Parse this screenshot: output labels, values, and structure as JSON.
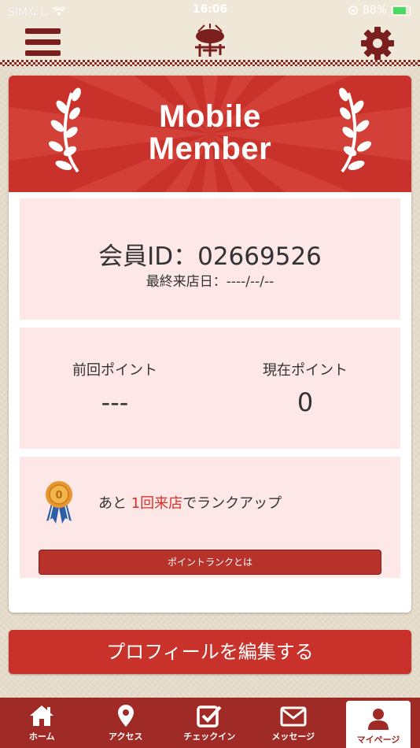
{
  "status": {
    "carrier": "SIMなし",
    "time": "16:06",
    "battery": "88%"
  },
  "header": {
    "logo_alt": "丼 logo"
  },
  "card": {
    "banner_title_line1": "Mobile",
    "banner_title_line2": "Member",
    "member_id_label": "会員ID：",
    "member_id": "02669526",
    "last_visit": "最終来店日：----/--/--",
    "prev_points_label": "前回ポイント",
    "prev_points_value": "---",
    "current_points_label": "現在ポイント",
    "current_points_value": "0",
    "medal_number": "0",
    "rank_prefix": "あと ",
    "rank_highlight": "1回来店",
    "rank_suffix": "でランクアップ",
    "rank_button": "ポイントランクとは"
  },
  "edit_profile_button": "プロフィールを編集する",
  "tabs": [
    {
      "label": "ホーム",
      "icon": "home-icon"
    },
    {
      "label": "アクセス",
      "icon": "location-pin-icon"
    },
    {
      "label": "チェックイン",
      "icon": "checkbox-icon"
    },
    {
      "label": "メッセージ",
      "icon": "envelope-icon"
    },
    {
      "label": "マイページ",
      "icon": "user-icon"
    }
  ],
  "colors": {
    "primary": "#c8322b",
    "dark": "#7a1f1d",
    "panel": "#fde7e7",
    "highlight": "#d9322a"
  }
}
